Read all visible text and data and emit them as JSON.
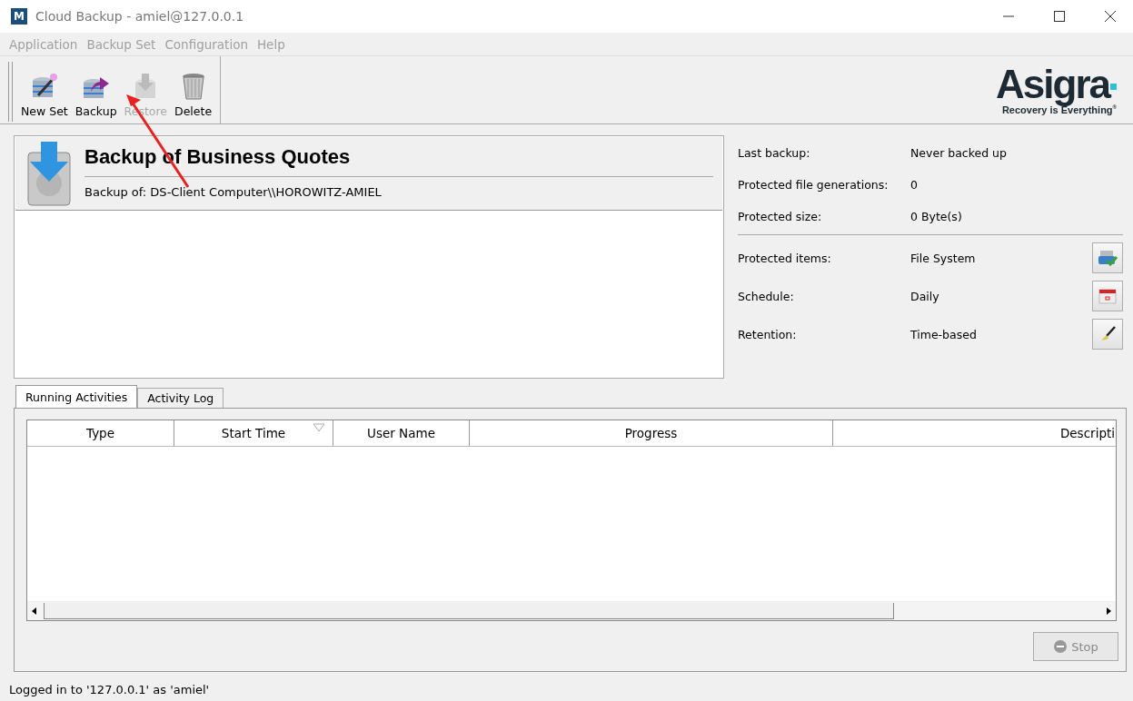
{
  "window": {
    "title": "Cloud Backup - amiel@127.0.0.1",
    "app_icon_letter": "M"
  },
  "menu": [
    {
      "label": "Application",
      "disabled": true
    },
    {
      "label": "Backup Set",
      "disabled": true
    },
    {
      "label": "Configuration",
      "disabled": true
    },
    {
      "label": "Help",
      "disabled": true
    }
  ],
  "toolbar": [
    {
      "kind": "new",
      "label": "New Set",
      "disabled": false
    },
    {
      "kind": "backup",
      "label": "Backup",
      "disabled": false
    },
    {
      "kind": "restore",
      "label": "Restore",
      "disabled": true
    },
    {
      "kind": "delete",
      "label": "Delete",
      "disabled": false
    }
  ],
  "logo": {
    "name": "Asigra",
    "tagline": "Recovery is Everything",
    "mark": "®"
  },
  "backup_set": {
    "title": "Backup of Business Quotes",
    "subtitle": "Backup of: DS-Client Computer\\\\HOROWITZ-AMIEL"
  },
  "stats": [
    {
      "label": "Last backup:",
      "value": "Never backed up"
    },
    {
      "label": "Protected file generations:",
      "value": "0"
    },
    {
      "label": "Protected size:",
      "value": "0 Byte(s)"
    }
  ],
  "settings": [
    {
      "kind": "items",
      "label": "Protected items:",
      "value": "File System"
    },
    {
      "kind": "schedule",
      "label": "Schedule:",
      "value": "Daily"
    },
    {
      "kind": "retention",
      "label": "Retention:",
      "value": "Time-based"
    }
  ],
  "tabs": [
    {
      "label": "Running Activities",
      "selected": true
    },
    {
      "label": "Activity Log",
      "selected": false
    }
  ],
  "table": {
    "columns": [
      {
        "label": "Type",
        "sorted": false
      },
      {
        "label": "Start Time",
        "sorted": true
      },
      {
        "label": "User Name",
        "sorted": false
      },
      {
        "label": "Progress",
        "sorted": false
      },
      {
        "label": "Descripti",
        "sorted": false
      }
    ]
  },
  "stop_button": {
    "label": "Stop",
    "disabled": true
  },
  "status_bar": "Logged in to '127.0.0.1' as 'amiel'",
  "annotation": {
    "kind": "arrow"
  }
}
